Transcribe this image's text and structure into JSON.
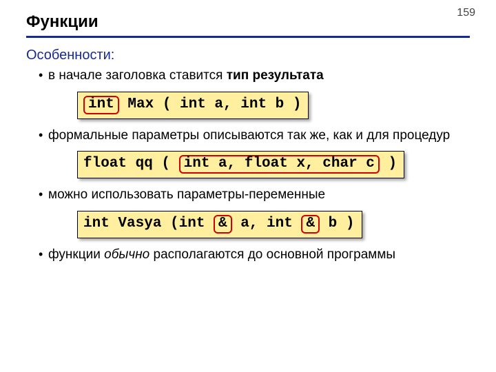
{
  "page_number": "159",
  "title": "Функции",
  "subheading": "Особенности:",
  "bullets": {
    "b1_pre": "в начале заголовка ставится ",
    "b1_bold": "тип результата",
    "b2": "формальные параметры описываются так же, как и для процедур",
    "b3": "можно использовать параметры-переменные",
    "b4_pre": "функции ",
    "b4_ital": "обычно",
    "b4_post": " располагаются до основной программы"
  },
  "code1": {
    "red": "int",
    "rest": " Max ( int a, int b )"
  },
  "code2": {
    "pre": "float qq ( ",
    "red": "int a, float x, char c",
    "post": " )"
  },
  "code3": {
    "pre": "int Vasya (int ",
    "red1": "&",
    "mid": " a, int ",
    "red2": "&",
    "post": " b )"
  }
}
